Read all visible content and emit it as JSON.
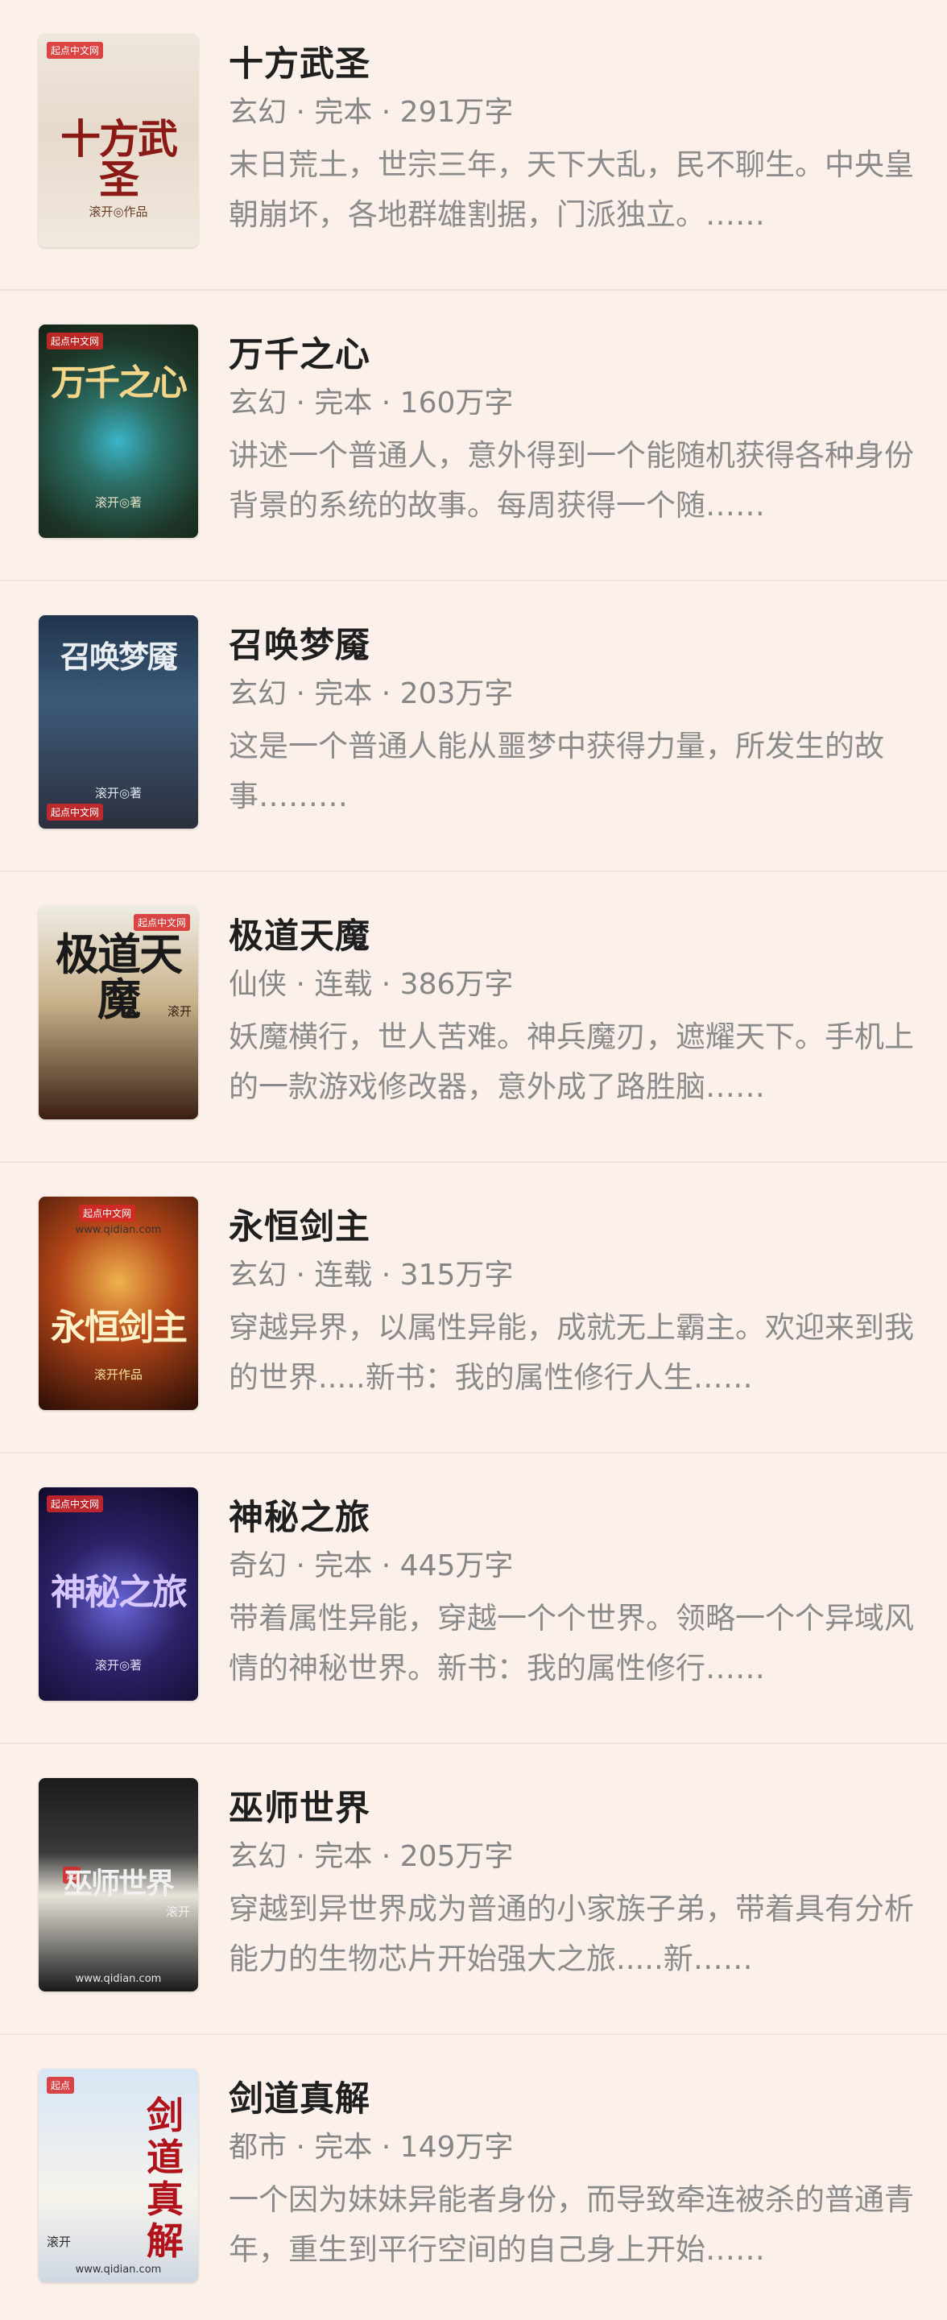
{
  "books": [
    {
      "title": "十方武圣",
      "meta": "玄幻 · 完本 · 291万字",
      "desc": "末日荒土，世宗三年，天下大乱，民不聊生。中央皇朝崩坏，各地群雄割据，门派独立。……",
      "cover": {
        "title": "十方武圣",
        "author": "滚开◎作品",
        "publisher": "起点中文网",
        "site": ""
      }
    },
    {
      "title": "万千之心",
      "meta": "玄幻 · 完本 · 160万字",
      "desc": "讲述一个普通人，意外得到一个能随机获得各种身份背景的系统的故事。每周获得一个随……",
      "cover": {
        "title": "万千之心",
        "author": "滚开◎著",
        "publisher": "起点中文网",
        "site": ""
      }
    },
    {
      "title": "召唤梦魇",
      "meta": "玄幻 · 完本 · 203万字",
      "desc": "这是一个普通人能从噩梦中获得力量，所发生的故事………",
      "cover": {
        "title": "召唤梦魇",
        "author": "滚开◎著",
        "publisher": "起点中文网",
        "site": ""
      }
    },
    {
      "title": "极道天魔",
      "meta": "仙侠 · 连载 · 386万字",
      "desc": "妖魔横行，世人苦难。神兵魔刃，遮耀天下。手机上的一款游戏修改器，意外成了路胜脑……",
      "cover": {
        "title": "极道天魔",
        "author": "滚开",
        "publisher": "起点中文网",
        "site": ""
      }
    },
    {
      "title": "永恒剑主",
      "meta": "玄幻 · 连载 · 315万字",
      "desc": "穿越异界，以属性异能，成就无上霸主。欢迎来到我的世界.....新书：我的属性修行人生……",
      "cover": {
        "title": "永恒剑主",
        "author": "滚开作品",
        "publisher": "起点中文网",
        "site": "www.qidian.com"
      }
    },
    {
      "title": "神秘之旅",
      "meta": "奇幻 · 完本 · 445万字",
      "desc": "带着属性异能，穿越一个个世界。领略一个个异域风情的神秘世界。新书：我的属性修行……",
      "cover": {
        "title": "神秘之旅",
        "author": "滚开◎著",
        "publisher": "起点中文网",
        "site": ""
      }
    },
    {
      "title": "巫师世界",
      "meta": "玄幻 · 完本 · 205万字",
      "desc": "穿越到异世界成为普通的小家族子弟，带着具有分析能力的生物芯片开始强大之旅.....新……",
      "cover": {
        "title": "巫师世界",
        "author": "滚开",
        "publisher": "起",
        "site": "www.qidian.com"
      }
    },
    {
      "title": "剑道真解",
      "meta": "都市 · 完本 · 149万字",
      "desc": "一个因为妹妹异能者身份，而导致牵连被杀的普通青年，重生到平行空间的自己身上开始……",
      "cover": {
        "title": "剑道真解",
        "author": "滚开",
        "publisher": "起点",
        "site": "www.qidian.com"
      }
    }
  ]
}
